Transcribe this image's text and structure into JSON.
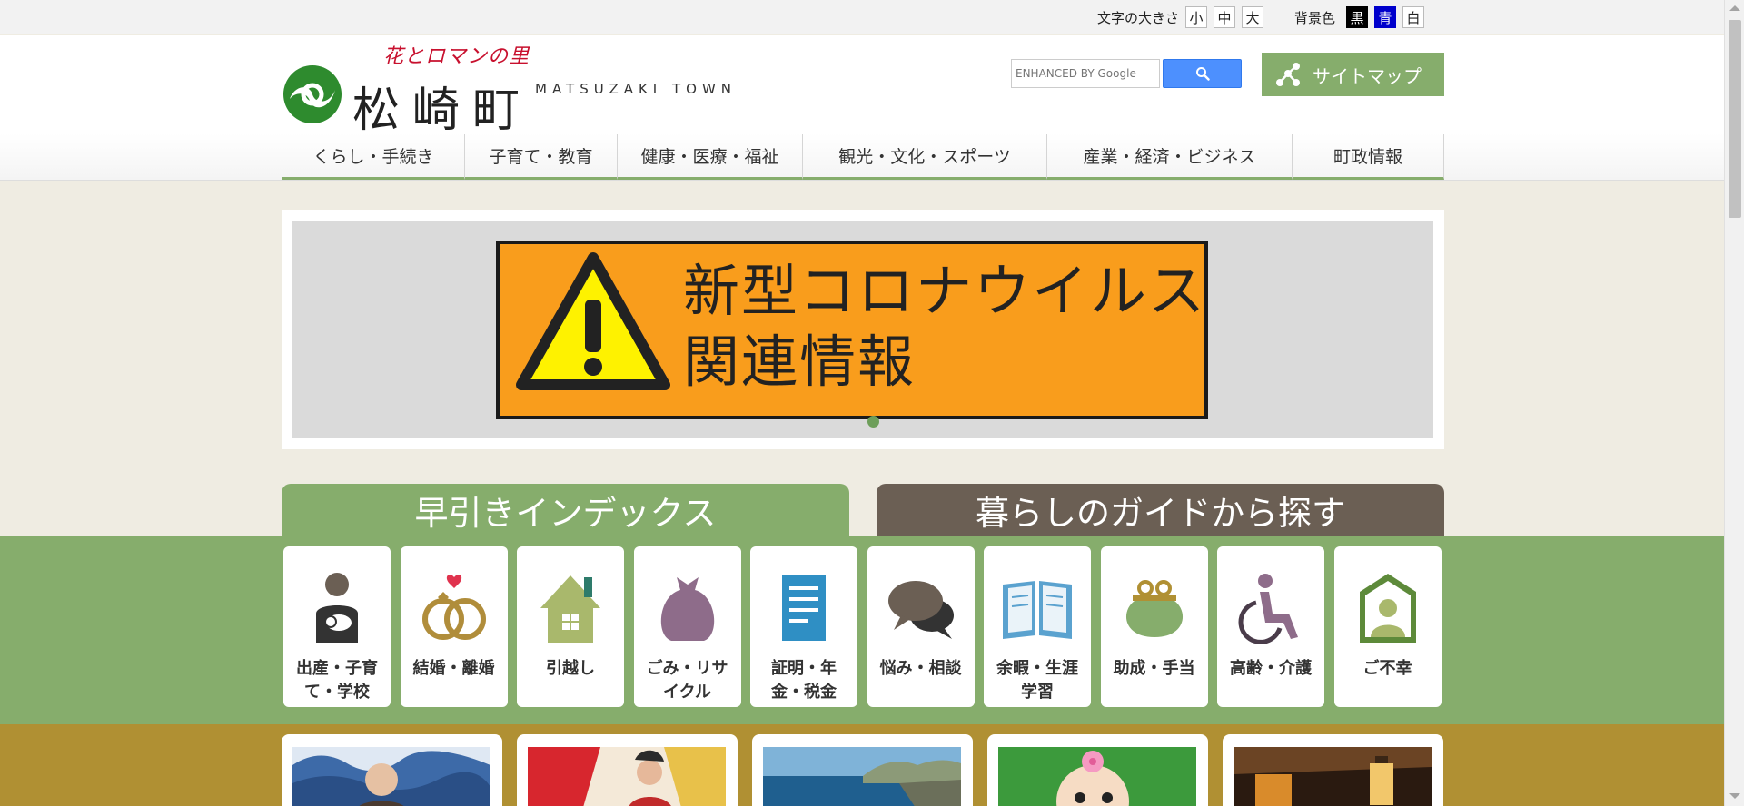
{
  "util": {
    "font_size_label": "文字の大きさ",
    "font_sizes": [
      "小",
      "中",
      "大"
    ],
    "bg_label": "背景色",
    "bg_colors": [
      "黒",
      "青",
      "白"
    ]
  },
  "logo": {
    "catchphrase": "花とロマンの里",
    "name": "松崎町",
    "name_en": "MATSUZAKI TOWN"
  },
  "search": {
    "placeholder": "ENHANCED BY Google"
  },
  "sitemap_label": "サイトマップ",
  "nav": [
    "くらし・手続き",
    "子育て・教育",
    "健康・医療・福祉",
    "観光・文化・スポーツ",
    "産業・経済・ビジネス",
    "町政情報"
  ],
  "banner": {
    "line1": "新型コロナウイルス",
    "line2": "関連情報"
  },
  "tabs": {
    "quick_index": "早引きインデックス",
    "life_guide": "暮らしのガイドから探す"
  },
  "index_items": [
    {
      "label": "出産・子育て・学校",
      "icon": "baby-icon"
    },
    {
      "label": "結婚・離婚",
      "icon": "rings-icon"
    },
    {
      "label": "引越し",
      "icon": "house-icon"
    },
    {
      "label": "ごみ・リサイクル",
      "icon": "garbage-bag-icon"
    },
    {
      "label": "証明・年金・税金",
      "icon": "document-icon"
    },
    {
      "label": "悩み・相談",
      "icon": "chat-icon"
    },
    {
      "label": "余暇・生涯学習",
      "icon": "book-icon"
    },
    {
      "label": "助成・手当",
      "icon": "purse-icon"
    },
    {
      "label": "高齢・介護",
      "icon": "wheelchair-icon"
    },
    {
      "label": "ご不幸",
      "icon": "memorial-icon"
    }
  ],
  "colors": {
    "green": "#86ad6c",
    "brown": "#6b5f54",
    "gold": "#b09033",
    "banner_orange": "#f99d1c"
  }
}
